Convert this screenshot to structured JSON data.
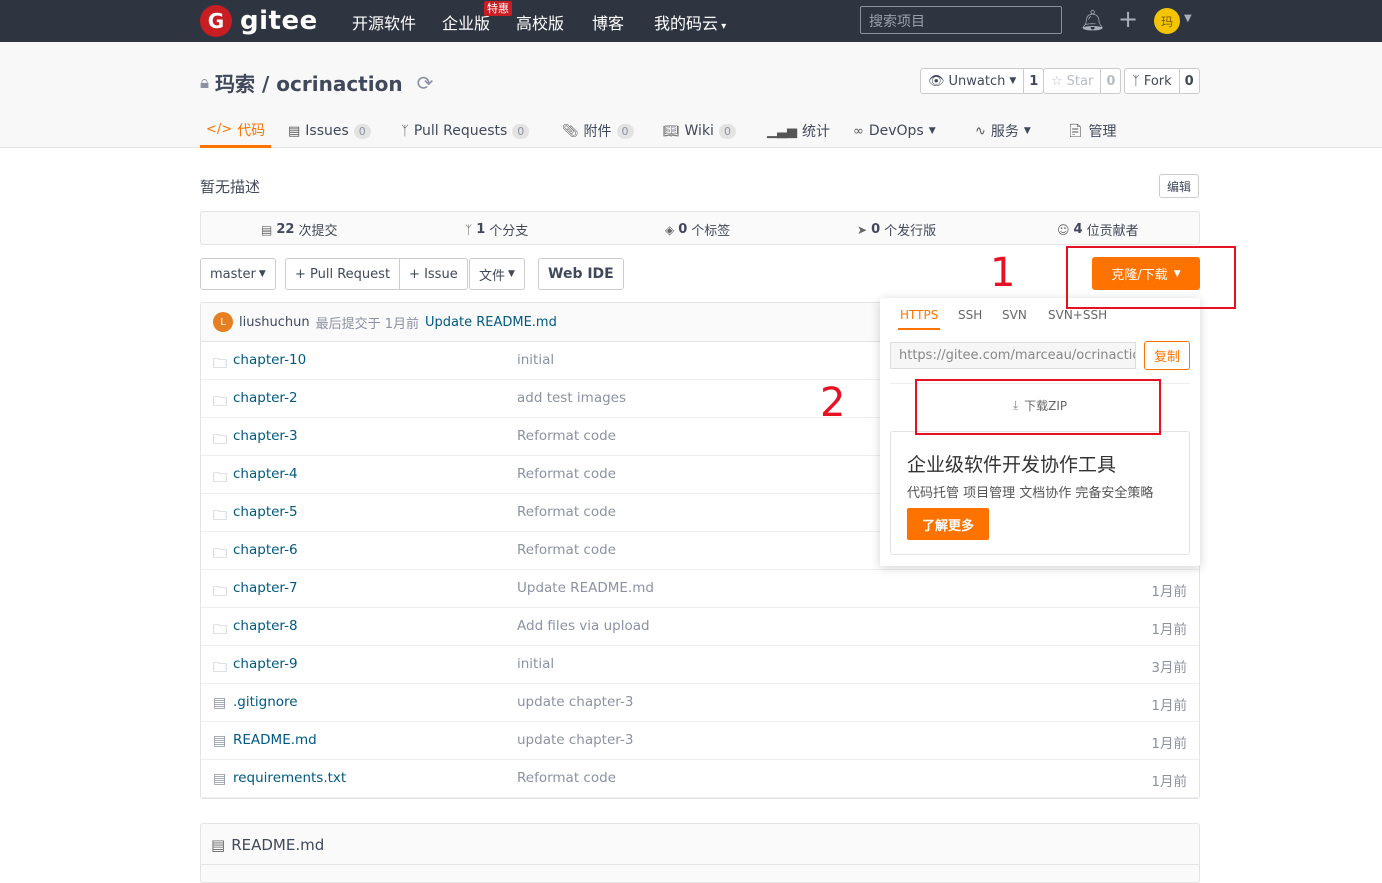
{
  "topnav": {
    "logo_letter": "G",
    "logo_text": "gitee",
    "items": [
      "开源软件",
      "企业版",
      "高校版",
      "博客",
      "我的码云"
    ],
    "enterprise_badge": "特惠",
    "search_placeholder": "搜索项目",
    "user_initial": "玛"
  },
  "project": {
    "title": "玛索 / ocrinaction",
    "unwatch_label": "Unwatch",
    "unwatch_count": "1",
    "star_label": "Star",
    "star_count": "0",
    "fork_label": "Fork",
    "fork_count": "0"
  },
  "tabs": [
    {
      "label": "代码"
    },
    {
      "label": "Issues",
      "count": "0"
    },
    {
      "label": "Pull Requests",
      "count": "0"
    },
    {
      "label": "附件",
      "count": "0"
    },
    {
      "label": "Wiki",
      "count": "0"
    },
    {
      "label": "统计"
    },
    {
      "label": "DevOps"
    },
    {
      "label": "服务"
    },
    {
      "label": "管理"
    }
  ],
  "description": "暂无描述",
  "edit_label": "编辑",
  "stats": {
    "commits_num": "22",
    "commits_text": "次提交",
    "branches_num": "1",
    "branches_text": "个分支",
    "tags_num": "0",
    "tags_text": "个标签",
    "releases_num": "0",
    "releases_text": "个发行版",
    "contributors_num": "4",
    "contributors_text": "位贡献者"
  },
  "toolbar": {
    "branch": "master",
    "pull_request": "+ Pull Request",
    "issue": "+ Issue",
    "files": "文件",
    "web_ide": "Web IDE",
    "clone": "克隆/下载"
  },
  "last_commit": {
    "avatar": "L",
    "user": "liushuchun",
    "meta": "最后提交于 1月前",
    "message": "Update README.md"
  },
  "files": [
    {
      "type": "folder",
      "name": "chapter-10",
      "message": "initial",
      "time": ""
    },
    {
      "type": "folder",
      "name": "chapter-2",
      "message": "add test images",
      "time": ""
    },
    {
      "type": "folder",
      "name": "chapter-3",
      "message": "Reformat code",
      "time": ""
    },
    {
      "type": "folder",
      "name": "chapter-4",
      "message": "Reformat code",
      "time": ""
    },
    {
      "type": "folder",
      "name": "chapter-5",
      "message": "Reformat code",
      "time": ""
    },
    {
      "type": "folder",
      "name": "chapter-6",
      "message": "Reformat code",
      "time": ""
    },
    {
      "type": "folder",
      "name": "chapter-7",
      "message": "Update README.md",
      "time": "1月前"
    },
    {
      "type": "folder",
      "name": "chapter-8",
      "message": "Add files via upload",
      "time": "1月前"
    },
    {
      "type": "folder",
      "name": "chapter-9",
      "message": "initial",
      "time": "3月前"
    },
    {
      "type": "file",
      "name": ".gitignore",
      "message": "update chapter-3",
      "time": "1月前"
    },
    {
      "type": "file",
      "name": "README.md",
      "message": "update chapter-3",
      "time": "1月前"
    },
    {
      "type": "file",
      "name": "requirements.txt",
      "message": "Reformat code",
      "time": "1月前"
    }
  ],
  "readme_title": "README.md",
  "dropdown": {
    "tabs": [
      "HTTPS",
      "SSH",
      "SVN",
      "SVN+SSH"
    ],
    "url": "https://gitee.com/marceau/ocrinaction",
    "copy": "复制",
    "download_zip": "下载ZIP",
    "promo_title": "企业级软件开发协作工具",
    "promo_sub": "代码托管 项目管理 文档协作 完备安全策略",
    "promo_button": "了解更多"
  },
  "annotations": {
    "first": "1",
    "second": "2"
  },
  "colors": {
    "accent": "#fe7300",
    "nav_bg": "#2f3540",
    "annotation": "#e81123",
    "link": "#005980"
  }
}
